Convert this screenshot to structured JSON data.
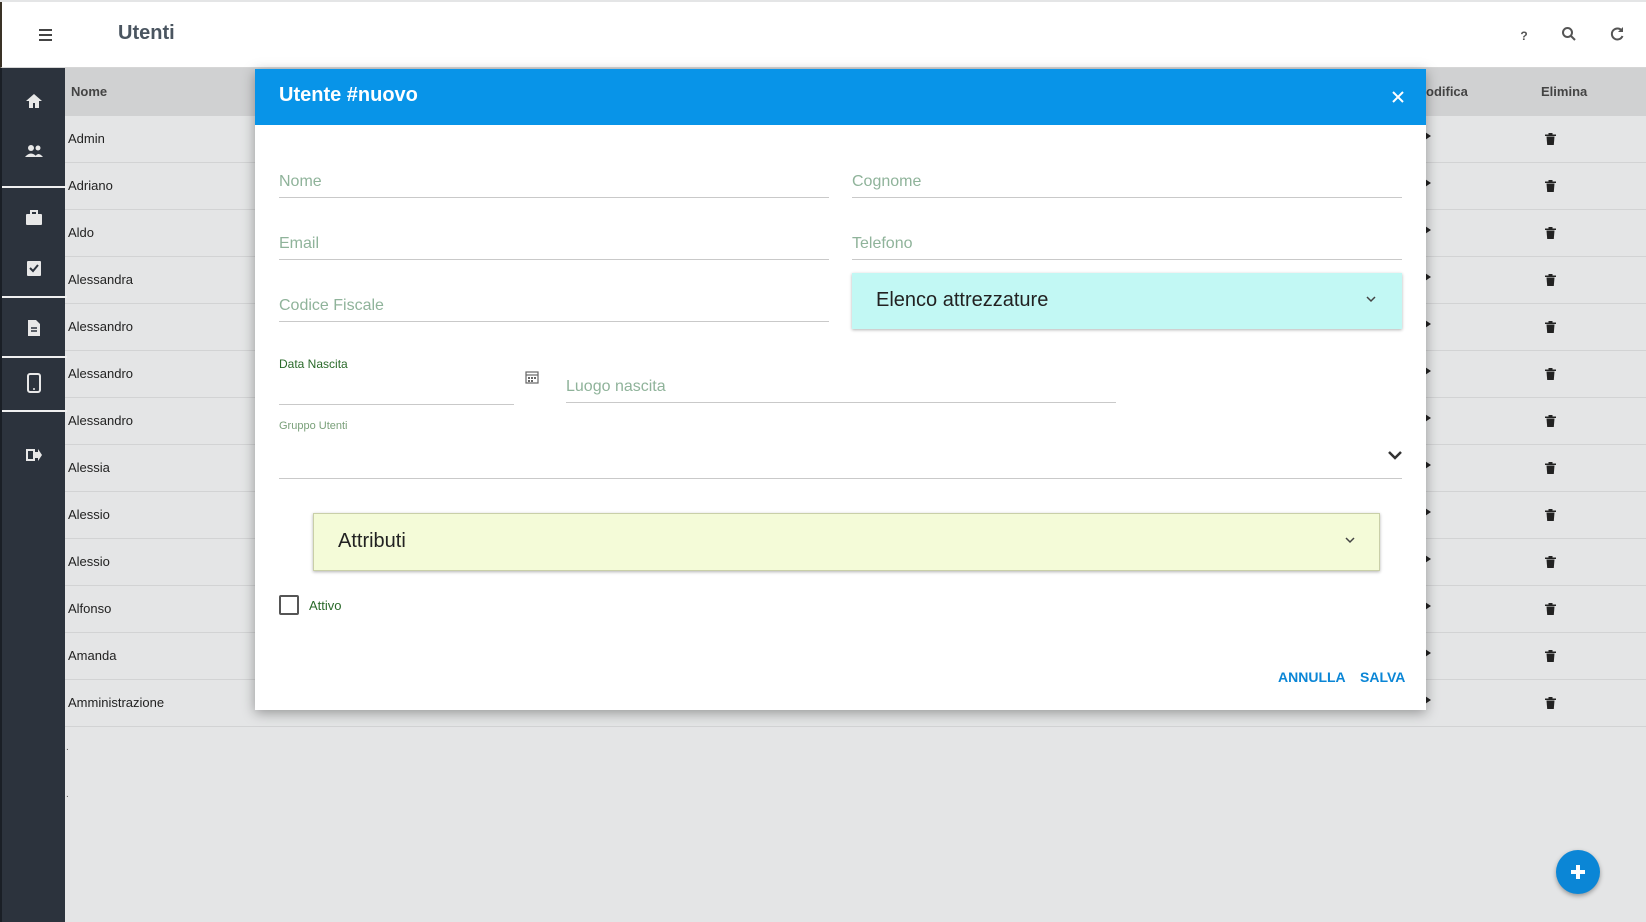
{
  "app": {
    "title": "Utenti"
  },
  "topbar": {
    "help_label": "?"
  },
  "colors": {
    "accent": "#0894e8",
    "sidebar": "#2c333d",
    "attrezzature_bg": "#c2f8f4",
    "attributi_bg": "#f4fbd8"
  },
  "sidebar": {
    "items": [
      {
        "icon": "home-icon"
      },
      {
        "icon": "users-icon"
      },
      {
        "icon": "briefcase-icon"
      },
      {
        "icon": "clipboard-check-icon"
      },
      {
        "icon": "document-icon"
      },
      {
        "icon": "tablet-icon"
      },
      {
        "icon": "logout-icon"
      }
    ]
  },
  "table": {
    "headers": {
      "name": "Nome",
      "edit": "odifica",
      "delete": "Elimina"
    },
    "rows": [
      "Admin",
      "Adriano",
      "Aldo",
      "Alessandra",
      "Alessandro",
      "Alessandro",
      "Alessandro",
      "Alessia",
      "Alessio",
      "Alessio",
      "Alfonso",
      "Amanda",
      "Amministrazione"
    ],
    "trailing_dots": [
      ".",
      "."
    ]
  },
  "modal": {
    "title": "Utente #nuovo",
    "fields": {
      "nome": {
        "placeholder": "Nome",
        "value": ""
      },
      "cognome": {
        "placeholder": "Cognome",
        "value": ""
      },
      "email": {
        "placeholder": "Email",
        "value": ""
      },
      "telefono": {
        "placeholder": "Telefono",
        "value": ""
      },
      "codice_fiscale": {
        "placeholder": "Codice Fiscale",
        "value": ""
      },
      "data_nascita": {
        "label": "Data Nascita",
        "value": ""
      },
      "luogo_nascita": {
        "placeholder": "Luogo nascita",
        "value": ""
      },
      "gruppo_utenti": {
        "label": "Gruppo Utenti",
        "value": ""
      }
    },
    "accordions": {
      "attrezzature": "Elenco attrezzature",
      "attributi": "Attributi"
    },
    "attivo": {
      "label": "Attivo",
      "checked": false
    },
    "buttons": {
      "cancel": "ANNULLA",
      "save": "SALVA"
    }
  }
}
